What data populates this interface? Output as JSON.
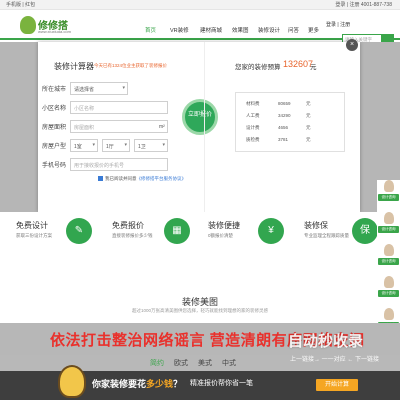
{
  "topbar": {
    "left_text": "手机版 | 红包",
    "right_text": "登录 | 注册  4001-887-738"
  },
  "header": {
    "logo_name": "修修搭",
    "logo_sub": "www.xiuxiuda.com",
    "nav": [
      "首页",
      "VR装修",
      "建材商城",
      "效果图",
      "装修设计",
      "问答",
      "更多"
    ],
    "login_text": "登录 | 注册",
    "search_placeholder": "请输入关键字"
  },
  "calculator": {
    "title": "装修计算器",
    "tip": "今天已有1324位业主获取了装修报价",
    "close": "×",
    "fields": {
      "city_label": "所在城市",
      "city_value": "请选择省",
      "community_label": "小区名称",
      "community_placeholder": "小区名称",
      "area_label": "房屋面积",
      "area_placeholder": "房屋面积",
      "area_unit": "m²",
      "layout_label": "房屋户型",
      "rooms": [
        "1室",
        "1厅",
        "1卫"
      ],
      "phone_label": "手机号码",
      "phone_placeholder": "用于接收报价的手机号"
    },
    "calc_button": "立即报价",
    "agree_text": "我已阅读并同意",
    "agree_link": "《修修搭平台服务协议》"
  },
  "budget": {
    "label": "您家的装修预算",
    "value": "132607",
    "unit": "元",
    "rows": [
      {
        "k": "材料费",
        "v": "80659",
        "u": "元"
      },
      {
        "k": "人工费",
        "v": "34290",
        "u": "元"
      },
      {
        "k": "设计费",
        "v": "4656",
        "u": "元"
      },
      {
        "k": "质检费",
        "v": "3781",
        "u": "元"
      }
    ]
  },
  "features": [
    {
      "title": "免费设计",
      "desc": "获取三份设计方案",
      "icon": "✎"
    },
    {
      "title": "免费报价",
      "desc": "直接装修报价多少钱",
      "icon": "▦"
    },
    {
      "title": "装修便捷",
      "desc": "0额报价清楚",
      "icon": "¥"
    },
    {
      "title": "装修保",
      "desc": "专业监理全程跟踪质量",
      "icon": "保"
    }
  ],
  "float_labels": [
    "设计咨询",
    "设计咨询",
    "设计咨询",
    "设计咨询",
    "设计咨询",
    "设计咨询"
  ],
  "gallery": {
    "title": "装修美图",
    "sub": "超过1000万张高清美图供您选择，轻巧就能找到理想的家的装修灵感"
  },
  "banner_text": "依法打击整治网络谣言  营造清朗有序网络空间",
  "style_tabs": [
    "简约",
    "欧式",
    "美式",
    "中式"
  ],
  "bottom": {
    "text1_pre": "你家装修要花",
    "text1_hl": "多少钱",
    "text1_post": "？",
    "text2": "精准报价帮你省一笔",
    "button": "开始计算"
  },
  "watermark": {
    "big": "自动秒收录",
    "small": "上一链接→ 一一对应 ← 下一链接"
  }
}
